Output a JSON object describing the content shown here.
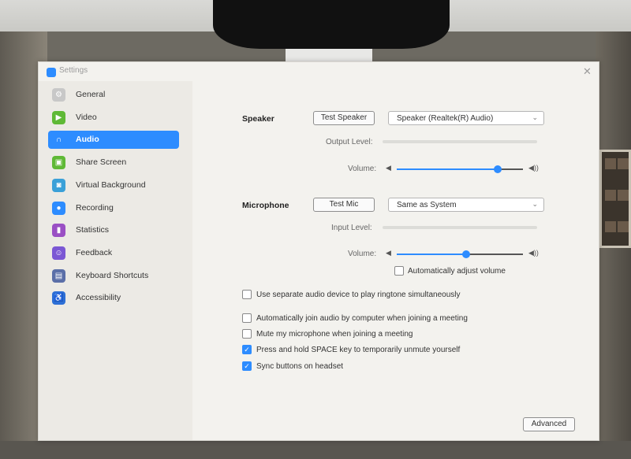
{
  "window": {
    "title": "Settings"
  },
  "sidebar": {
    "items": [
      {
        "label": "General",
        "icon": "gear-icon",
        "color": "#c8c8c8"
      },
      {
        "label": "Video",
        "icon": "video-camera-icon",
        "color": "#5fb936"
      },
      {
        "label": "Audio",
        "icon": "headphones-icon",
        "color": "#2d8cff",
        "active": true
      },
      {
        "label": "Share Screen",
        "icon": "share-screen-icon",
        "color": "#5fb936"
      },
      {
        "label": "Virtual Background",
        "icon": "virtual-background-icon",
        "color": "#3aa0d8"
      },
      {
        "label": "Recording",
        "icon": "recording-icon",
        "color": "#2d8cff"
      },
      {
        "label": "Statistics",
        "icon": "statistics-icon",
        "color": "#9a4fc4"
      },
      {
        "label": "Feedback",
        "icon": "feedback-icon",
        "color": "#7b57d4"
      },
      {
        "label": "Keyboard Shortcuts",
        "icon": "keyboard-icon",
        "color": "#5b6fa8"
      },
      {
        "label": "Accessibility",
        "icon": "accessibility-icon",
        "color": "#2d6fd6"
      }
    ]
  },
  "speaker": {
    "label": "Speaker",
    "test_button": "Test Speaker",
    "device": "Speaker (Realtek(R) Audio)",
    "output_level_label": "Output Level:",
    "volume_label": "Volume:",
    "volume": 0.8
  },
  "microphone": {
    "label": "Microphone",
    "test_button": "Test Mic",
    "device": "Same as System",
    "input_level_label": "Input Level:",
    "volume_label": "Volume:",
    "volume": 0.55,
    "auto_adjust_label": "Automatically adjust volume",
    "auto_adjust": false
  },
  "options": {
    "separate_device": {
      "label": "Use separate audio device to play ringtone simultaneously",
      "checked": false
    },
    "auto_join": {
      "label": "Automatically join audio by computer when joining a meeting",
      "checked": false
    },
    "mute_mic": {
      "label": "Mute my microphone when joining a meeting",
      "checked": false
    },
    "press_space": {
      "label": "Press and hold SPACE key to temporarily unmute yourself",
      "checked": true
    },
    "sync_buttons": {
      "label": "Sync buttons on headset",
      "checked": true
    }
  },
  "advanced_button": "Advanced",
  "accent_color": "#2d8cff"
}
